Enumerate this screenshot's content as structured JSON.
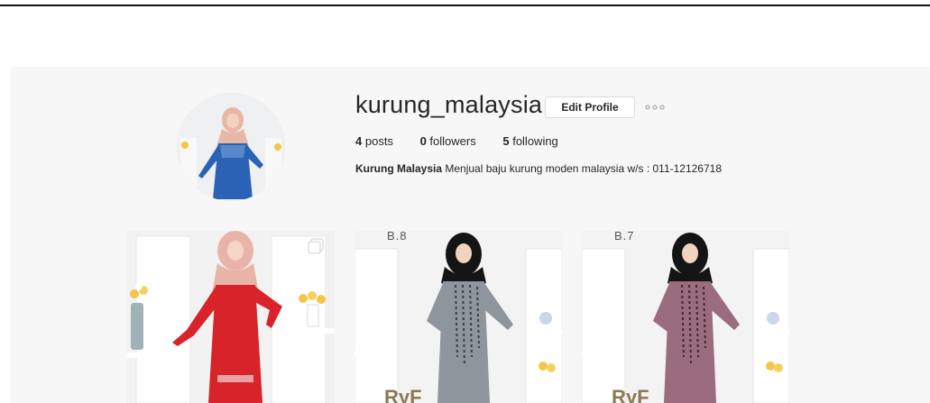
{
  "profile": {
    "username": "kurung_malaysia",
    "edit_profile_label": "Edit Profile",
    "stats": [
      {
        "count": "4",
        "label": "posts"
      },
      {
        "count": "0",
        "label": "followers"
      },
      {
        "count": "5",
        "label": "following"
      }
    ],
    "bio_name": "Kurung Malaysia",
    "bio_text": " Menjual baju kurung moden malaysia w/s : 011-12126718"
  },
  "posts": [
    {
      "dress_color": "#d8232a",
      "hijab_color": "#e9b4a8",
      "label": ""
    },
    {
      "dress_color": "#8f959c",
      "hijab_color": "#141414",
      "label": "B.8",
      "brand": "RyF"
    },
    {
      "dress_color": "#9a6c7d",
      "hijab_color": "#141414",
      "label": "B.7",
      "brand": "RyF"
    }
  ],
  "colors": {
    "avatar_dress": "#2a63b5",
    "border": "#dbdbdb",
    "bg": "#f7f7f7"
  },
  "icons": {
    "more": "more-options-icon",
    "multi": "multiple-images-icon"
  }
}
